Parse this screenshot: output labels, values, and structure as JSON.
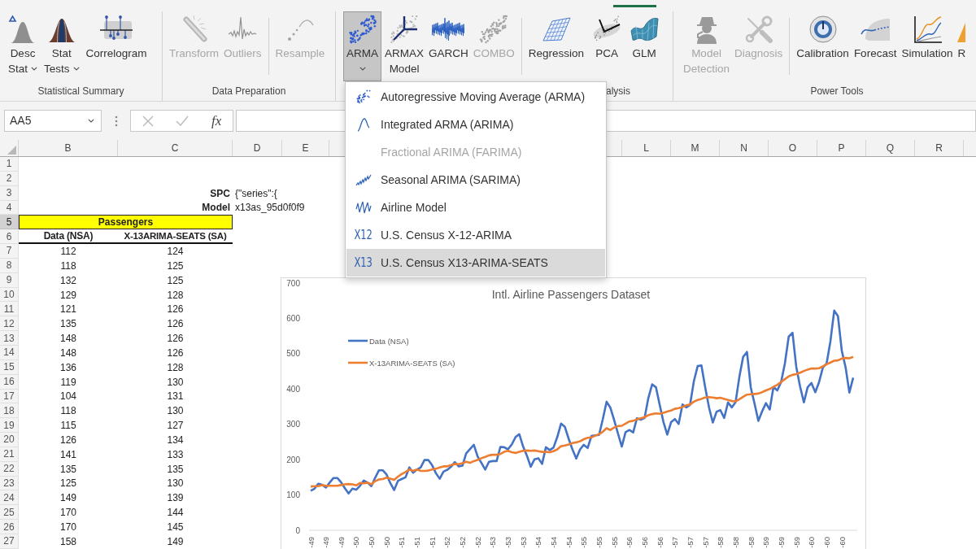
{
  "ribbon": {
    "tabs": [
      {
        "selected": true
      }
    ],
    "groups": [
      {
        "label": "Statistical Summary",
        "sections": [
          [
            {
              "label": [
                "Desc",
                "Stat"
              ],
              "menu": true,
              "disabled": false,
              "pressed": false
            },
            {
              "label": [
                "Stat",
                "Tests"
              ],
              "menu": true,
              "disabled": false,
              "pressed": false
            },
            {
              "label": [
                "Correlogram"
              ],
              "menu": false,
              "disabled": false,
              "pressed": false
            }
          ]
        ]
      },
      {
        "label": "Data Preparation",
        "sections": [
          [
            {
              "label": [
                "Transform"
              ],
              "menu": false,
              "disabled": true,
              "pressed": false
            },
            {
              "label": [
                "Outliers"
              ],
              "menu": false,
              "disabled": true,
              "pressed": false
            }
          ],
          [
            {
              "label": [
                "Resample"
              ],
              "menu": false,
              "disabled": true,
              "pressed": false
            }
          ]
        ]
      },
      {
        "label": "alysis",
        "sections": [
          [
            {
              "label": [
                "ARMA"
              ],
              "menu": true,
              "disabled": false,
              "pressed": true
            },
            {
              "label": [
                "ARMAX",
                "Model"
              ],
              "menu": false,
              "disabled": false,
              "pressed": false
            },
            {
              "label": [
                "GARCH"
              ],
              "menu": false,
              "disabled": false,
              "pressed": false
            },
            {
              "label": [
                "COMBO"
              ],
              "menu": false,
              "disabled": true,
              "pressed": false
            }
          ],
          [
            {
              "label": [
                "Regression"
              ],
              "menu": false,
              "disabled": false,
              "pressed": false
            },
            {
              "label": [
                "PCA"
              ],
              "menu": false,
              "disabled": false,
              "pressed": false
            },
            {
              "label": [
                "GLM"
              ],
              "menu": false,
              "disabled": false,
              "pressed": false
            }
          ]
        ]
      },
      {
        "label": "Power Tools",
        "sections": [
          [
            {
              "label": [
                "Model",
                "Detection"
              ],
              "menu": false,
              "disabled": true,
              "pressed": false
            },
            {
              "label": [
                "Diagnosis"
              ],
              "menu": false,
              "disabled": true,
              "pressed": false
            }
          ],
          [
            {
              "label": [
                "Calibration"
              ],
              "menu": false,
              "disabled": false,
              "pressed": false
            },
            {
              "label": [
                "Forecast"
              ],
              "menu": false,
              "disabled": false,
              "pressed": false
            },
            {
              "label": [
                "Simulation"
              ],
              "menu": false,
              "disabled": false,
              "pressed": false
            },
            {
              "label": [
                "R"
              ],
              "menu": false,
              "disabled": false,
              "pressed": false
            }
          ]
        ]
      }
    ]
  },
  "arma_menu": {
    "items": [
      {
        "label": "Autoregressive Moving Average (ARMA)",
        "disabled": false,
        "selected": false
      },
      {
        "label": "Integrated ARMA (ARIMA)",
        "disabled": false,
        "selected": false
      },
      {
        "label": "Fractional ARIMA (FARIMA)",
        "disabled": true,
        "selected": false
      },
      {
        "label": "Seasonal ARIMA (SARIMA)",
        "disabled": false,
        "selected": false
      },
      {
        "label": "Airline Model",
        "disabled": false,
        "selected": false
      },
      {
        "label": "U.S. Census X-12-ARIMA",
        "glyph": "X12",
        "disabled": false,
        "selected": false
      },
      {
        "label": "U.S. Census X13-ARIMA-SEATS",
        "glyph": "X13",
        "disabled": false,
        "selected": true
      }
    ]
  },
  "formula_bar": {
    "name_box": "AA5",
    "cancel": {
      "disabled": true
    },
    "enter": {
      "disabled": true
    },
    "function_label": "fx"
  },
  "sheet": {
    "columns": [
      "B",
      "C",
      "D",
      "E",
      "L",
      "M",
      "N",
      "O",
      "P",
      "Q",
      "R"
    ],
    "rows": [
      {
        "number": "1",
        "selected": false,
        "kind": "blank"
      },
      {
        "number": "2",
        "selected": false,
        "kind": "blank"
      },
      {
        "number": "3",
        "selected": false,
        "kind": "param",
        "label": "SPC",
        "value": "{\"series\":{"
      },
      {
        "number": "4",
        "selected": false,
        "kind": "param",
        "label": "Model",
        "value": "x13as_95d0f0f9"
      },
      {
        "number": "5",
        "selected": true,
        "kind": "title",
        "title": "Passengers"
      },
      {
        "number": "6",
        "selected": false,
        "kind": "header",
        "headers": [
          "Data (NSA)",
          "X-13ARIMA-SEATS (SA)"
        ]
      },
      {
        "number": "7",
        "selected": false,
        "kind": "data",
        "values": [
          "112",
          "124"
        ]
      },
      {
        "number": "8",
        "selected": false,
        "kind": "data",
        "values": [
          "118",
          "125"
        ]
      },
      {
        "number": "9",
        "selected": false,
        "kind": "data",
        "values": [
          "132",
          "125"
        ]
      },
      {
        "number": "10",
        "selected": false,
        "kind": "data",
        "values": [
          "129",
          "128"
        ]
      },
      {
        "number": "11",
        "selected": false,
        "kind": "data",
        "values": [
          "121",
          "126"
        ]
      },
      {
        "number": "12",
        "selected": false,
        "kind": "data",
        "values": [
          "135",
          "126"
        ]
      },
      {
        "number": "13",
        "selected": false,
        "kind": "data",
        "values": [
          "148",
          "126"
        ]
      },
      {
        "number": "14",
        "selected": false,
        "kind": "data",
        "values": [
          "148",
          "126"
        ]
      },
      {
        "number": "15",
        "selected": false,
        "kind": "data",
        "values": [
          "136",
          "128"
        ]
      },
      {
        "number": "16",
        "selected": false,
        "kind": "data",
        "values": [
          "119",
          "130"
        ]
      },
      {
        "number": "17",
        "selected": false,
        "kind": "data",
        "values": [
          "104",
          "131"
        ]
      },
      {
        "number": "18",
        "selected": false,
        "kind": "data",
        "values": [
          "118",
          "130"
        ]
      },
      {
        "number": "19",
        "selected": false,
        "kind": "data",
        "values": [
          "115",
          "127"
        ]
      },
      {
        "number": "20",
        "selected": false,
        "kind": "data",
        "values": [
          "126",
          "134"
        ]
      },
      {
        "number": "21",
        "selected": false,
        "kind": "data",
        "values": [
          "141",
          "133"
        ]
      },
      {
        "number": "22",
        "selected": false,
        "kind": "data",
        "values": [
          "135",
          "135"
        ]
      },
      {
        "number": "23",
        "selected": false,
        "kind": "data",
        "values": [
          "125",
          "130"
        ]
      },
      {
        "number": "24",
        "selected": false,
        "kind": "data",
        "values": [
          "149",
          "139"
        ]
      },
      {
        "number": "25",
        "selected": false,
        "kind": "data",
        "values": [
          "170",
          "144"
        ]
      },
      {
        "number": "26",
        "selected": false,
        "kind": "data",
        "values": [
          "170",
          "145"
        ]
      },
      {
        "number": "27",
        "selected": false,
        "kind": "data",
        "values": [
          "158",
          "149"
        ]
      }
    ]
  },
  "chart": {
    "chart_data": {
      "type": "line",
      "title": "Intl. Airline Passengers Dataset",
      "ylim": [
        0,
        700
      ],
      "yticks": [
        0,
        100,
        200,
        300,
        400,
        500,
        600,
        700
      ],
      "legend": "upper left",
      "categories": [
        "-49",
        null,
        null,
        null,
        "-49",
        null,
        null,
        null,
        "-49",
        null,
        null,
        null,
        "-50",
        null,
        null,
        null,
        "-50",
        null,
        null,
        null,
        "-50",
        null,
        null,
        null,
        "-51",
        null,
        null,
        null,
        "-51",
        null,
        null,
        null,
        "-51",
        null,
        null,
        null,
        "-52",
        null,
        null,
        null,
        "-52",
        null,
        null,
        null,
        "-52",
        null,
        null,
        null,
        "-53",
        null,
        null,
        null,
        "-53",
        null,
        null,
        null,
        "-53",
        null,
        null,
        null,
        "-54",
        null,
        null,
        null,
        "-54",
        null,
        null,
        null,
        "-54",
        null,
        null,
        null,
        "-55",
        null,
        null,
        null,
        "-55",
        null,
        null,
        null,
        "-55",
        null,
        null,
        null,
        "-56",
        null,
        null,
        null,
        "-56",
        null,
        null,
        null,
        "-56",
        null,
        null,
        null,
        "-57",
        null,
        null,
        null,
        "-57",
        null,
        null,
        null,
        "-57",
        null,
        null,
        null,
        "-58",
        null,
        null,
        null,
        "-58",
        null,
        null,
        null,
        "-58",
        null,
        null,
        null,
        "-59",
        null,
        null,
        null,
        "-59",
        null,
        null,
        null,
        "-59",
        null,
        null,
        null,
        "-60",
        null,
        null,
        null,
        "-60",
        null,
        null,
        null,
        "-60",
        null,
        null,
        null
      ],
      "series": [
        {
          "name": "Data (NSA)",
          "color": "#4472c4",
          "values": [
            112,
            118,
            132,
            129,
            121,
            135,
            148,
            148,
            136,
            119,
            104,
            118,
            115,
            126,
            141,
            135,
            125,
            149,
            170,
            170,
            158,
            133,
            114,
            140,
            145,
            150,
            178,
            163,
            172,
            178,
            199,
            199,
            184,
            162,
            146,
            166,
            171,
            180,
            193,
            181,
            183,
            218,
            230,
            242,
            209,
            191,
            172,
            194,
            196,
            196,
            236,
            235,
            229,
            243,
            264,
            272,
            237,
            211,
            180,
            201,
            204,
            188,
            235,
            227,
            234,
            264,
            302,
            293,
            259,
            229,
            203,
            229,
            242,
            233,
            267,
            269,
            270,
            315,
            364,
            347,
            312,
            274,
            237,
            278,
            284,
            277,
            317,
            313,
            318,
            374,
            413,
            405,
            355,
            306,
            271,
            306,
            315,
            301,
            356,
            348,
            355,
            422,
            465,
            467,
            404,
            347,
            305,
            336,
            340,
            318,
            362,
            348,
            363,
            435,
            491,
            505,
            404,
            359,
            310,
            337,
            360,
            342,
            406,
            396,
            420,
            472,
            548,
            559,
            463,
            407,
            362,
            405,
            417,
            391,
            419,
            461,
            472,
            535,
            622,
            606,
            508,
            461,
            390,
            432
          ]
        },
        {
          "name": "X-13ARIMA-SEATS (SA)",
          "color": "#ed7d31",
          "values": [
            124,
            125,
            125,
            128,
            126,
            126,
            126,
            126,
            128,
            130,
            131,
            130,
            127,
            134,
            133,
            135,
            130,
            139,
            144,
            145,
            149,
            146,
            143,
            152,
            159,
            165,
            172,
            168,
            172,
            168,
            168,
            169,
            172,
            174,
            178,
            181,
            181,
            185,
            188,
            187,
            190,
            194,
            191,
            196,
            199,
            204,
            208,
            212,
            214,
            214,
            216,
            222,
            225,
            221,
            219,
            222,
            225,
            226,
            225,
            226,
            224,
            222,
            222,
            221,
            224,
            229,
            238,
            240,
            243,
            247,
            249,
            252,
            258,
            262,
            263,
            268,
            272,
            279,
            289,
            284,
            291,
            295,
            296,
            302,
            308,
            310,
            314,
            317,
            320,
            326,
            329,
            331,
            330,
            333,
            336,
            339,
            344,
            346,
            349,
            354,
            356,
            364,
            369,
            372,
            376,
            377,
            376,
            374,
            375,
            372,
            369,
            366,
            365,
            371,
            378,
            384,
            385,
            386,
            387,
            391,
            396,
            400,
            406,
            412,
            420,
            428,
            436,
            440,
            442,
            446,
            451,
            455,
            458,
            458,
            459,
            464,
            470,
            475,
            480,
            481,
            486,
            488,
            487,
            491
          ]
        }
      ]
    }
  }
}
